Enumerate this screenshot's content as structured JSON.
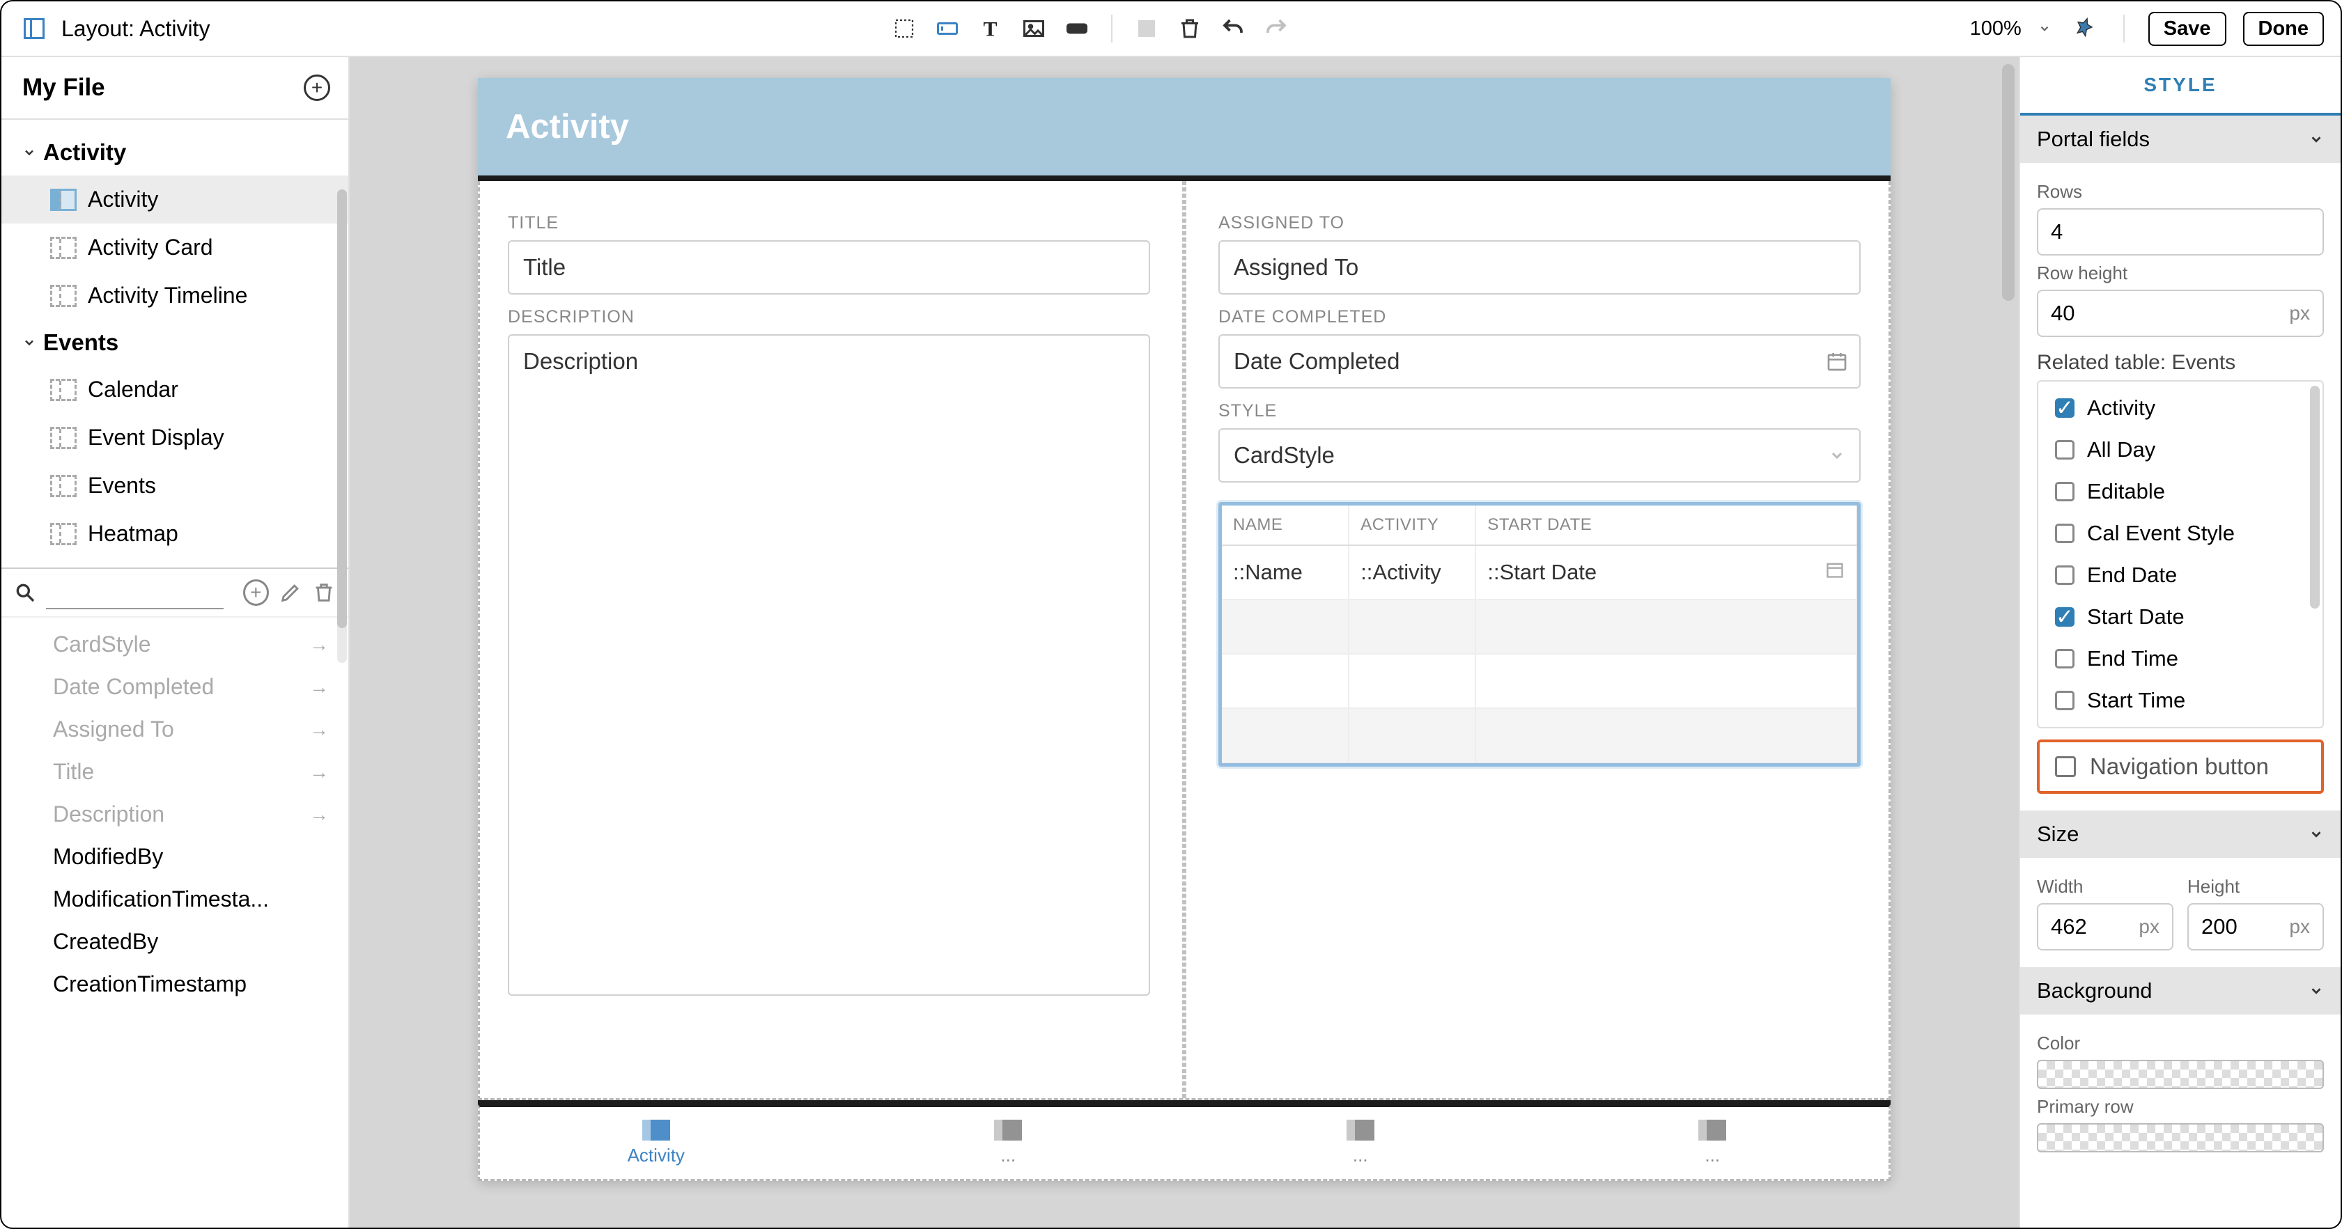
{
  "topbar": {
    "layout_label": "Layout: Activity",
    "zoom": "100%",
    "save": "Save",
    "done": "Done"
  },
  "sidebar": {
    "file_title": "My File",
    "groups": [
      {
        "name": "Activity",
        "items": [
          "Activity",
          "Activity Card",
          "Activity Timeline"
        ]
      },
      {
        "name": "Events",
        "items": [
          "Calendar",
          "Event Display",
          "Events",
          "Heatmap"
        ]
      }
    ]
  },
  "fields": {
    "used": [
      "CardStyle",
      "Date Completed",
      "Assigned To",
      "Title",
      "Description"
    ],
    "unused": [
      "ModifiedBy",
      "ModificationTimesta...",
      "CreatedBy",
      "CreationTimestamp"
    ]
  },
  "canvas": {
    "header": "Activity",
    "title_label": "TITLE",
    "title_value": "Title",
    "desc_label": "DESCRIPTION",
    "desc_value": "Description",
    "assigned_label": "ASSIGNED TO",
    "assigned_value": "Assigned To",
    "completed_label": "DATE COMPLETED",
    "completed_value": "Date Completed",
    "style_label": "STYLE",
    "style_value": "CardStyle",
    "portal": {
      "cols": [
        "NAME",
        "ACTIVITY",
        "START DATE"
      ],
      "row": [
        "::Name",
        "::Activity",
        "::Start Date"
      ]
    },
    "tabs": [
      "Activity",
      "...",
      "...",
      "..."
    ]
  },
  "inspector": {
    "tab": "STYLE",
    "portal_fields": {
      "header": "Portal fields",
      "rows_label": "Rows",
      "rows_value": "4",
      "rowh_label": "Row height",
      "rowh_value": "40",
      "rowh_unit": "px",
      "related_label": "Related table: Events",
      "checks": [
        {
          "label": "Activity",
          "checked": true
        },
        {
          "label": "All Day",
          "checked": false
        },
        {
          "label": "Editable",
          "checked": false
        },
        {
          "label": "Cal Event Style",
          "checked": false
        },
        {
          "label": "End Date",
          "checked": false
        },
        {
          "label": "Start Date",
          "checked": true
        },
        {
          "label": "End Time",
          "checked": false
        },
        {
          "label": "Start Time",
          "checked": false
        }
      ],
      "nav_label": "Navigation button"
    },
    "size": {
      "header": "Size",
      "w_label": "Width",
      "w_value": "462",
      "w_unit": "px",
      "h_label": "Height",
      "h_value": "200",
      "h_unit": "px"
    },
    "background": {
      "header": "Background",
      "color_label": "Color",
      "primary_label": "Primary row"
    }
  }
}
